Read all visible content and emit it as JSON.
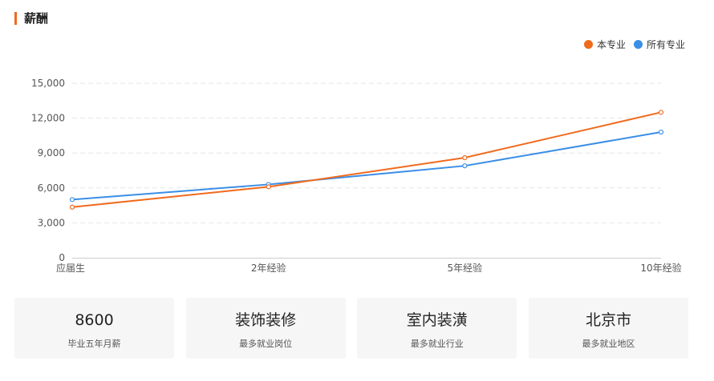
{
  "header": {
    "title": "薪酬",
    "accent_color": "#f06a1d"
  },
  "chart_data": {
    "type": "line",
    "categories": [
      "应届生",
      "2年经验",
      "5年经验",
      "10年经验"
    ],
    "series": [
      {
        "name": "本专业",
        "color": "#f06a1d",
        "values": [
          4350,
          6100,
          8600,
          12500
        ]
      },
      {
        "name": "所有专业",
        "color": "#3a8ee6",
        "values": [
          5000,
          6300,
          7900,
          10800
        ]
      }
    ],
    "yticks": [
      "0",
      "3,000",
      "6,000",
      "9,000",
      "12,000",
      "15,000"
    ],
    "ylim": [
      0,
      15000
    ],
    "grid": true,
    "legend_position": "top-right"
  },
  "cards": [
    {
      "value": "8600",
      "label": "毕业五年月薪"
    },
    {
      "value": "装饰装修",
      "label": "最多就业岗位"
    },
    {
      "value": "室内装潢",
      "label": "最多就业行业"
    },
    {
      "value": "北京市",
      "label": "最多就业地区"
    }
  ]
}
